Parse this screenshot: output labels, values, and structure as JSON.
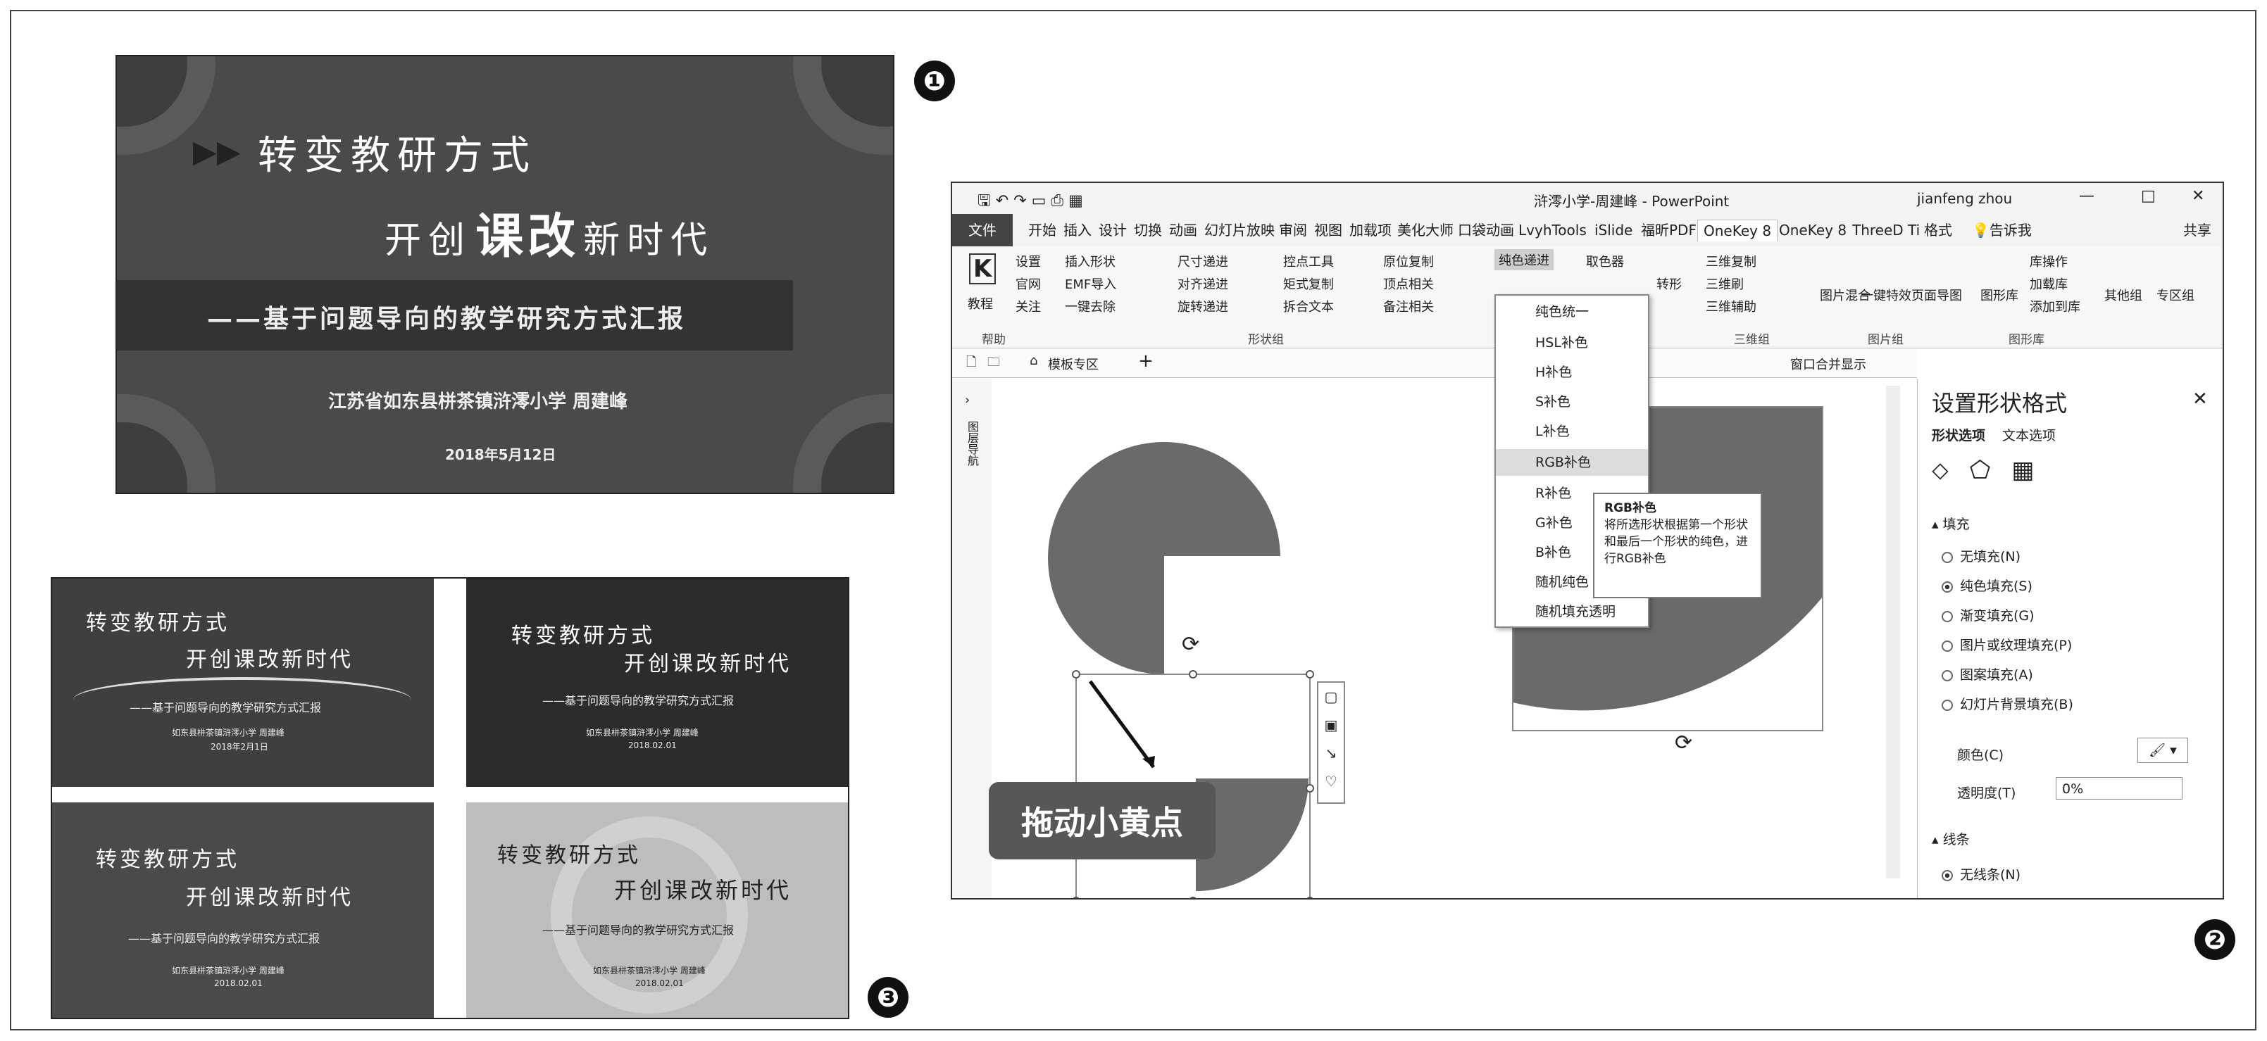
{
  "markers": [
    "❶",
    "❷",
    "❸"
  ],
  "slide1": {
    "line1": "转变教研方式",
    "line2_a": "开创",
    "line2_b": "课改",
    "line2_c": "新时代",
    "subtitle": "——基于问题导向的教学研究方式汇报",
    "author": "江苏省如东县栟茶镇浒澪小学  周建峰",
    "date": "2018年5月12日"
  },
  "thumbs": [
    {
      "l1": "转变教研方式",
      "l2": "开创课改新时代",
      "sub": "——基于问题导向的教学研究方式汇报",
      "author": "如东县栟茶镇浒澪小学  周建峰",
      "date": "2018年2月1日"
    },
    {
      "l1": "转变教研方式",
      "l2": "开创课改新时代",
      "sub": "——基于问题导向的教学研究方式汇报",
      "author": "如东县栟茶镇浒澪小学  周建峰",
      "date": "2018.02.01"
    },
    {
      "l1": "转变教研方式",
      "l2": "开创课改新时代",
      "sub": "——基于问题导向的教学研究方式汇报",
      "author": "如东县栟茶镇浒澪小学  周建峰",
      "date": "2018.02.01"
    },
    {
      "l1": "转变教研方式",
      "l2": "开创课改新时代",
      "sub": "——基于问题导向的教学研究方式汇报",
      "author": "如东县栟茶镇浒澪小学  周建峰",
      "date": "2018.02.01"
    }
  ],
  "ppt": {
    "window_title": "浒澪小学-周建峰 - PowerPoint",
    "user": "jianfeng zhou",
    "tabs": [
      "文件",
      "开始",
      "插入",
      "设计",
      "切换",
      "动画",
      "幻灯片放映",
      "审阅",
      "视图",
      "加载项",
      "美化大师",
      "口袋动画",
      "LvyhTools",
      "iSlide",
      "福昕PDF",
      "OneKey 8",
      "OneKey 8",
      "ThreeD Ti",
      "格式",
      "告诉我",
      "共享"
    ],
    "ribbon": {
      "help": [
        "设置",
        "官网",
        "关注",
        "教程"
      ],
      "shape": [
        "插入形状",
        "EMF导入",
        "一键去除",
        "尺寸递进",
        "对齐递进",
        "旋转递进",
        "控点工具",
        "矩式复制",
        "拆合文本",
        "原位复制",
        "顶点相关",
        "备注相关"
      ],
      "color": [
        "纯色递进",
        "取色器",
        "转形"
      ],
      "three_d": [
        "三维复制",
        "三维刷",
        "三维辅助"
      ],
      "image": [
        "图片混合",
        "一键特效",
        "页面导图",
        "图形库",
        "加载库",
        "添加到库",
        "库操作",
        "其他组",
        "专区组"
      ],
      "groups": [
        "帮助",
        "形状组",
        "三维组",
        "图片组",
        "图形库"
      ]
    },
    "doc_tab": "模板专区",
    "merge_display": "窗口合并显示",
    "side_label": "图层导航",
    "menu": [
      "纯色统一",
      "HSL补色",
      "H补色",
      "S补色",
      "L补色",
      "RGB补色",
      "R补色",
      "G补色",
      "B补色",
      "随机纯色",
      "随机填充透明"
    ],
    "tooltip_title": "RGB补色",
    "tooltip_body": "将所选形状根据第一个形状和最后一个形状的纯色，进行RGB补色",
    "callout": "拖动小黄点",
    "pane": {
      "title": "设置形状格式",
      "tab1": "形状选项",
      "tab2": "文本选项",
      "fill_section": "填充",
      "fill_options": [
        "无填充(N)",
        "纯色填充(S)",
        "渐变填充(G)",
        "图片或纹理填充(P)",
        "图案填充(A)",
        "幻灯片背景填充(B)"
      ],
      "selected_fill": 1,
      "color_label": "颜色(C)",
      "transparency_label": "透明度(T)",
      "transparency_value": "0%",
      "line_section": "线条",
      "line_option": "无线条(N)"
    }
  }
}
